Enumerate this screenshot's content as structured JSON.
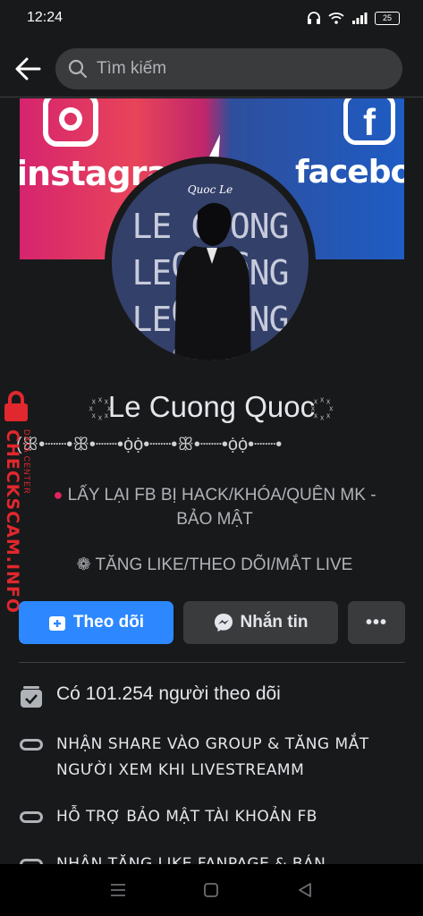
{
  "status_bar": {
    "time": "12:24",
    "battery": "25"
  },
  "search": {
    "placeholder": "Tìm kiếm"
  },
  "cover": {
    "left_text": "instagram",
    "right_text": "facebo"
  },
  "avatar": {
    "lines": [
      "LE CUONG QUOC",
      "LE CUONG QUOC",
      "LE CUONG QUOC"
    ],
    "signature": "Quoc Le"
  },
  "profile": {
    "name_deco_left": "꙰꙰꙰꙰",
    "name": "Le Cuong Quoc",
    "name_deco_right": "꙰꙰꙰꙰",
    "name_sub": "(ꕥ•┈┈•ꕥ•┈┈•ọ̇ọ̇•┈┈•ꕥ•┈┈•ọ̇ọ̇•┈┈•",
    "bio_line1": "LẤY LẠI FB BỊ HACK/KHÓA/QUÊN MK - BẢO MẬT",
    "bio_line2": "❁ TĂNG LIKE/THEO DÕI/MẮT LIVE"
  },
  "watermark": {
    "text": "CHECKSCAM.INFO",
    "sub": "DATA CENTER"
  },
  "actions": {
    "follow": "Theo dõi",
    "message": "Nhắn tin",
    "more": "•••"
  },
  "info": [
    {
      "text": "Có 101.254 người theo dõi"
    },
    {
      "text": "NHẬN SHARE VÀO GROUP & TĂNG MẮT NGƯỜI XEM KHI LIVESTREAMM"
    },
    {
      "text": "HỖ TRỢ BẢO MẬT TÀI KHOẢN FB"
    },
    {
      "text": "NHẬN TĂNG LIKE FANPAGE & BÁN"
    }
  ],
  "colors": {
    "primary": "#2d88ff",
    "background": "#18191a",
    "watermark": "#e0282e"
  }
}
